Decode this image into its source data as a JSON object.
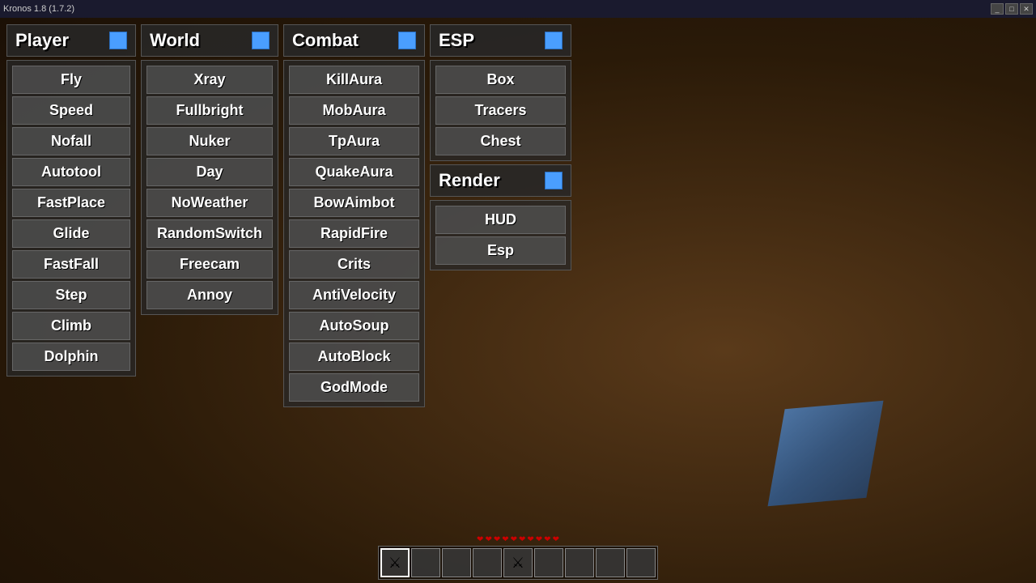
{
  "titlebar": {
    "title": "Kronos 1.8 (1.7.2)",
    "controls": [
      "_",
      "□",
      "✕"
    ]
  },
  "panels": {
    "player": {
      "header": "Player",
      "items": [
        "Fly",
        "Speed",
        "Nofall",
        "Autotool",
        "FastPlace",
        "Glide",
        "FastFall",
        "Step",
        "Climb",
        "Dolphin"
      ]
    },
    "world": {
      "header": "World",
      "items": [
        "Xray",
        "Fullbright",
        "Nuker",
        "Day",
        "NoWeather",
        "RandomSwitch",
        "Freecam",
        "Annoy"
      ]
    },
    "combat": {
      "header": "Combat",
      "items": [
        "KillAura",
        "MobAura",
        "TpAura",
        "QuakeAura",
        "BowAimbot",
        "RapidFire",
        "Crits",
        "AntiVelocity",
        "AutoSoup",
        "AutoBlock",
        "GodMode"
      ]
    },
    "esp": {
      "header": "ESP",
      "items": [
        "Box",
        "Tracers",
        "Chest"
      ]
    },
    "render": {
      "header": "Render",
      "items": [
        "HUD",
        "Esp"
      ]
    }
  },
  "hud": {
    "hearts": "❤❤❤❤❤❤❤❤❤❤",
    "slots": [
      "⚔",
      "",
      "",
      "",
      "",
      "",
      "",
      "",
      ""
    ]
  }
}
